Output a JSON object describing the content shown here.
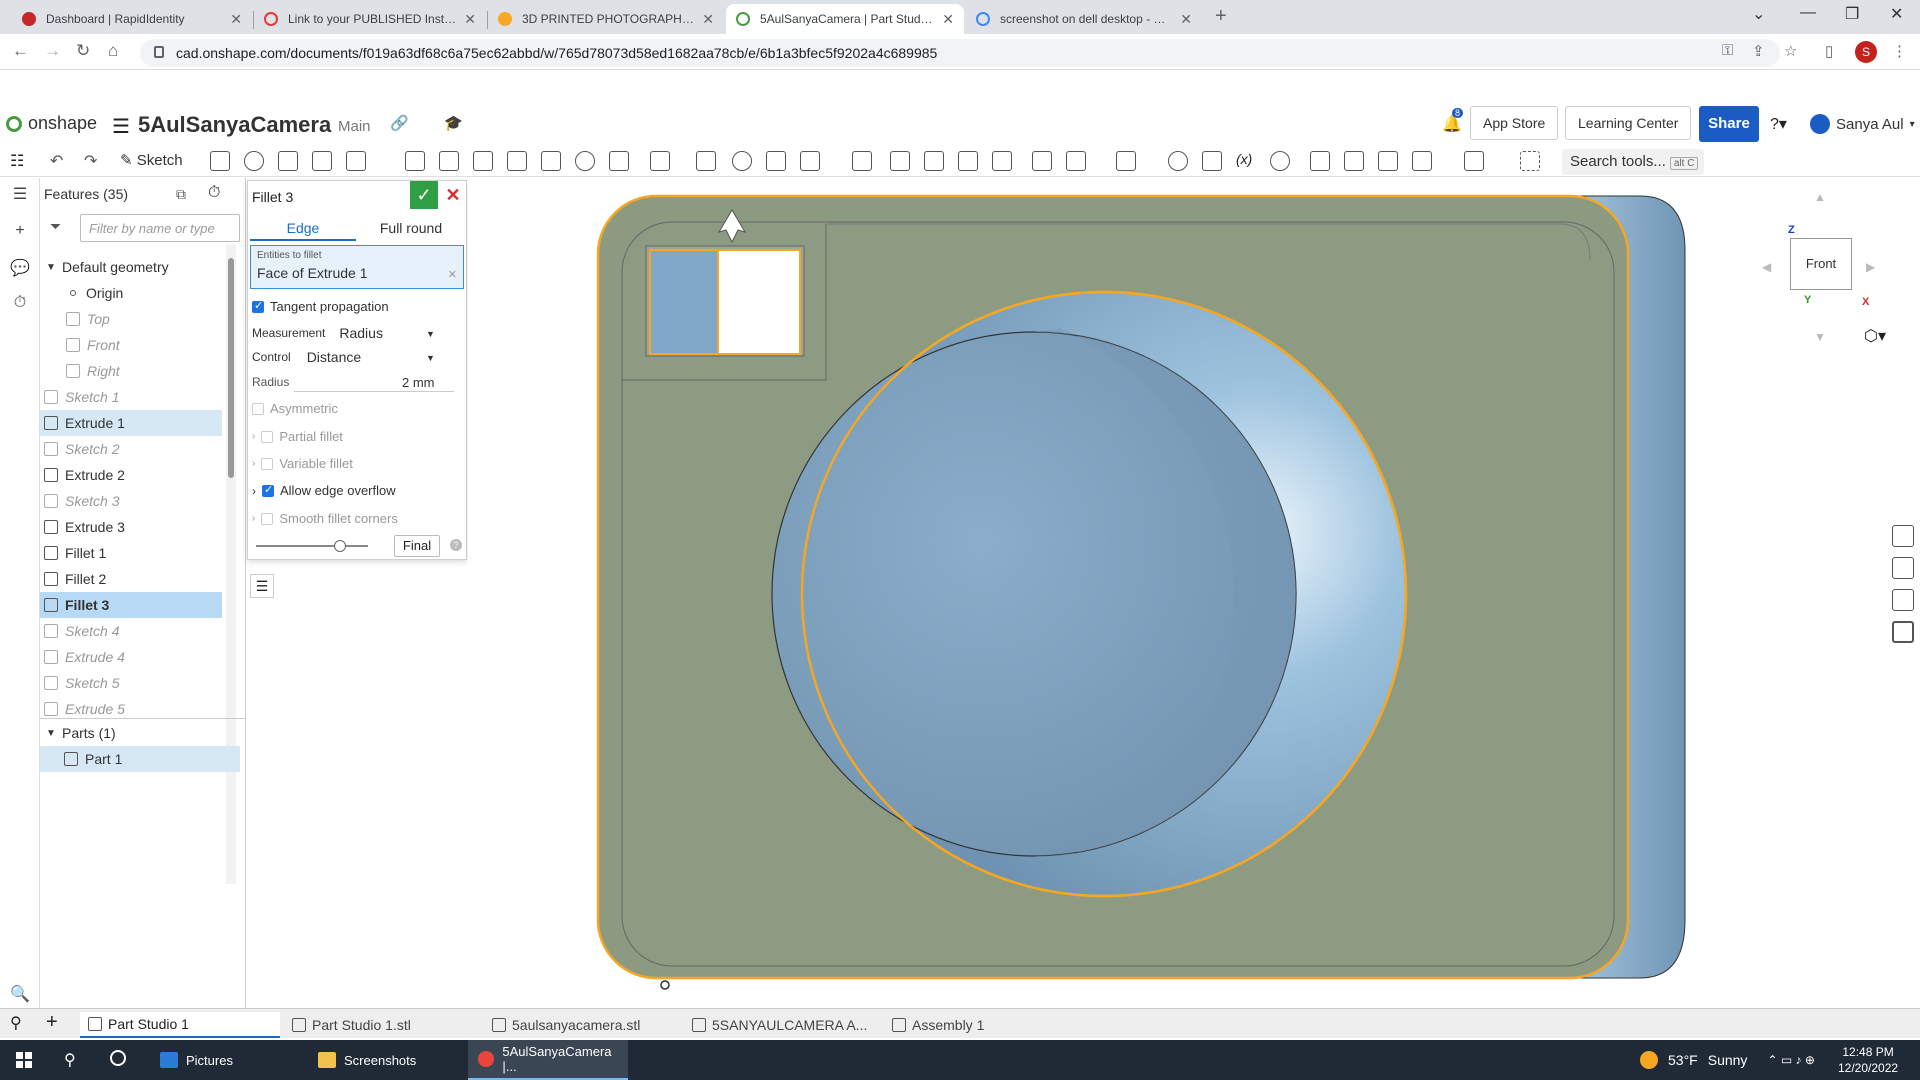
{
  "browser": {
    "tabs": [
      {
        "title": "Dashboard | RapidIdentity",
        "icon_color": "#c62828"
      },
      {
        "title": "Link to your PUBLISHED Instructa",
        "icon_color": "#e53935"
      },
      {
        "title": "3D PRINTED PHOTOGRAPHER TR",
        "icon_color": "#f9a825"
      },
      {
        "title": "5AulSanyaCamera | Part Studio 1",
        "icon_color": "#4a9b3f"
      },
      {
        "title": "screenshot on dell desktop - Goo",
        "icon_color": "#4285f4"
      }
    ],
    "url": "cad.onshape.com/documents/f019a63df68c6a75ec62abbd/w/765d78073d58ed1682aa78cb/e/6b1a3bfec5f9202a4c689985",
    "profile_letter": "S"
  },
  "onshape": {
    "logo": "onshape",
    "doc_name": "5AulSanyaCamera",
    "branch": "Main",
    "notifications": "8",
    "app_store": "App Store",
    "learning_center": "Learning Center",
    "share": "Share",
    "user": "Sanya Aul"
  },
  "toolbar": {
    "sketch": "Sketch",
    "search_tools": "Search tools...",
    "search_kbd": "alt C"
  },
  "features": {
    "header": "Features (35)",
    "filter_placeholder": "Filter by name or type",
    "default_geometry": "Default geometry",
    "items": [
      {
        "label": "Origin",
        "state": "normal"
      },
      {
        "label": "Top",
        "state": "dim"
      },
      {
        "label": "Front",
        "state": "dim"
      },
      {
        "label": "Right",
        "state": "dim"
      },
      {
        "label": "Sketch 1",
        "state": "dim"
      },
      {
        "label": "Extrude 1",
        "state": "sel"
      },
      {
        "label": "Sketch 2",
        "state": "dim"
      },
      {
        "label": "Extrude 2",
        "state": "normal"
      },
      {
        "label": "Sketch 3",
        "state": "dim"
      },
      {
        "label": "Extrude 3",
        "state": "normal"
      },
      {
        "label": "Fillet 1",
        "state": "normal"
      },
      {
        "label": "Fillet 2",
        "state": "normal"
      },
      {
        "label": "Fillet 3",
        "state": "hl"
      },
      {
        "label": "Sketch 4",
        "state": "dim"
      },
      {
        "label": "Extrude 4",
        "state": "dim"
      },
      {
        "label": "Sketch 5",
        "state": "dim"
      },
      {
        "label": "Extrude 5",
        "state": "dim"
      }
    ],
    "parts_header": "Parts (1)",
    "part": "Part 1"
  },
  "dialog": {
    "title": "Fillet 3",
    "tab_edge": "Edge",
    "tab_full": "Full round",
    "entities_label": "Entities to fillet",
    "entities_value": "Face of Extrude 1",
    "tangent": "Tangent propagation",
    "measurement_label": "Measurement",
    "measurement_value": "Radius",
    "control_label": "Control",
    "control_value": "Distance",
    "radius_label": "Radius",
    "radius_value": "2 mm",
    "asymmetric": "Asymmetric",
    "partial": "Partial fillet",
    "variable": "Variable fillet",
    "overflow": "Allow edge overflow",
    "smooth": "Smooth fillet corners",
    "final": "Final"
  },
  "viewcube": {
    "face": "Front",
    "z": "Z",
    "x": "X",
    "y": "Y"
  },
  "bottom_tabs": [
    "Part Studio 1",
    "Part Studio 1.stl",
    "5aulsanyacamera.stl",
    "5SANYAULCAMERA A...",
    "Assembly 1"
  ],
  "taskbar": {
    "items": [
      "Pictures",
      "Screenshots",
      "5AulSanyaCamera |..."
    ],
    "temp": "53°F",
    "weather": "Sunny",
    "time": "12:48 PM",
    "date": "12/20/2022"
  },
  "colors": {
    "accent": "#1a6fc4",
    "model_body": "#8c9a82",
    "model_lens": "#8fb6d4",
    "selection": "#f5a623"
  }
}
